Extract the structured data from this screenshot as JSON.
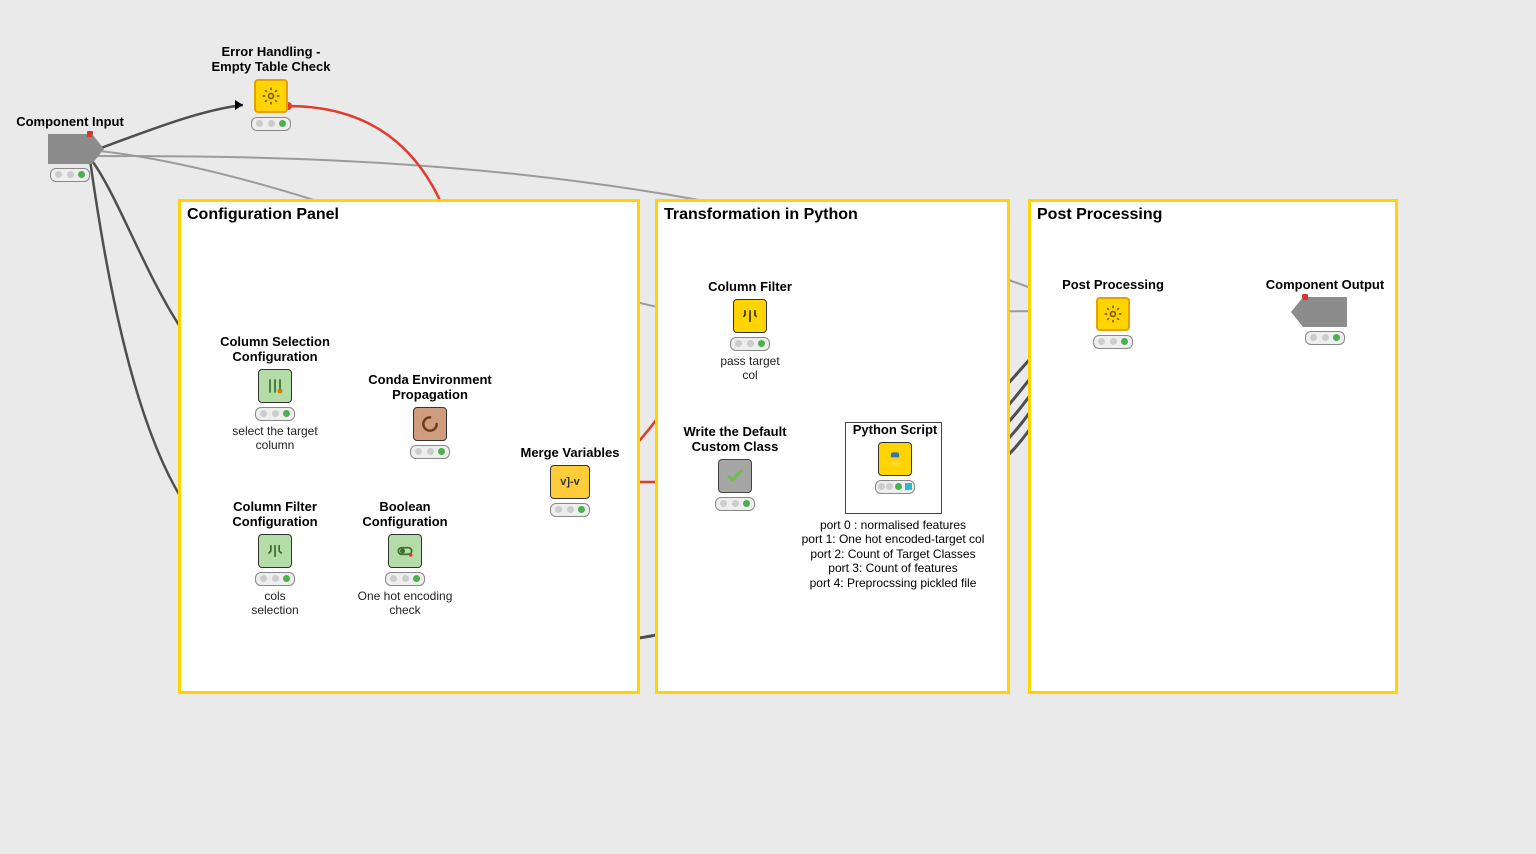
{
  "panels": {
    "config": {
      "title": "Configuration Panel"
    },
    "transform": {
      "title": "Transformation in Python"
    },
    "post": {
      "title": "Post Processing"
    }
  },
  "nodes": {
    "component_input": {
      "title": "Component Input"
    },
    "error_handling": {
      "title": "Error Handling -\nEmpty Table Check"
    },
    "col_sel_cfg": {
      "title": "Column Selection\nConfiguration",
      "subtitle": "select the target\ncolumn"
    },
    "col_filter_cfg": {
      "title": "Column Filter\nConfiguration",
      "subtitle": "cols\nselection"
    },
    "conda_env": {
      "title": "Conda Environment\nPropagation"
    },
    "bool_cfg": {
      "title": "Boolean\nConfiguration",
      "subtitle": "One hot encoding\ncheck"
    },
    "merge_vars": {
      "title": "Merge Variables"
    },
    "column_filter": {
      "title": "Column Filter",
      "subtitle": "pass target\ncol"
    },
    "write_default": {
      "title": "Write the Default\nCustom Class"
    },
    "python_script": {
      "title": "Python Script",
      "ports_text": "port 0 : normalised features\nport 1: One hot encoded-target col\nport 2: Count of Target Classes\nport 3: Count of features\nport 4: Preprocssing pickled file"
    },
    "post_processing": {
      "title": "Post Processing"
    },
    "component_output": {
      "title": "Component Output"
    }
  },
  "colors": {
    "flow_red": "#e23b2e",
    "data_gray": "#4f4f4f",
    "data_light_gray": "#9b9b9b"
  }
}
